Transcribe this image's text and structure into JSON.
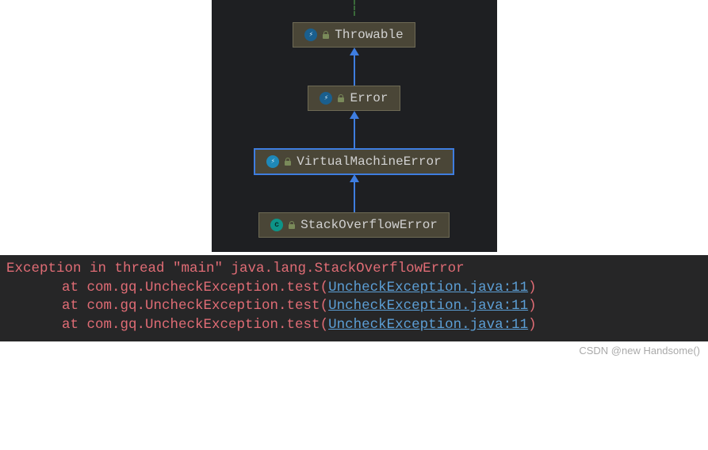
{
  "diagram": {
    "nodes": [
      {
        "label": "Throwable",
        "icon": "blue",
        "selected": false
      },
      {
        "label": "Error",
        "icon": "blue",
        "selected": false
      },
      {
        "label": "VirtualMachineError",
        "icon": "blue2",
        "selected": true
      },
      {
        "label": "StackOverflowError",
        "icon": "teal",
        "selected": false
      }
    ]
  },
  "stacktrace": {
    "header": "Exception in thread \"main\" java.lang.StackOverflowError",
    "frames": [
      {
        "prefix": "at com.gq.UncheckException.test",
        "link": "UncheckException.java:11"
      },
      {
        "prefix": "at com.gq.UncheckException.test",
        "link": "UncheckException.java:11"
      },
      {
        "prefix": "at com.gq.UncheckException.test",
        "link": "UncheckException.java:11"
      }
    ]
  },
  "watermark": "CSDN @new Handsome()"
}
